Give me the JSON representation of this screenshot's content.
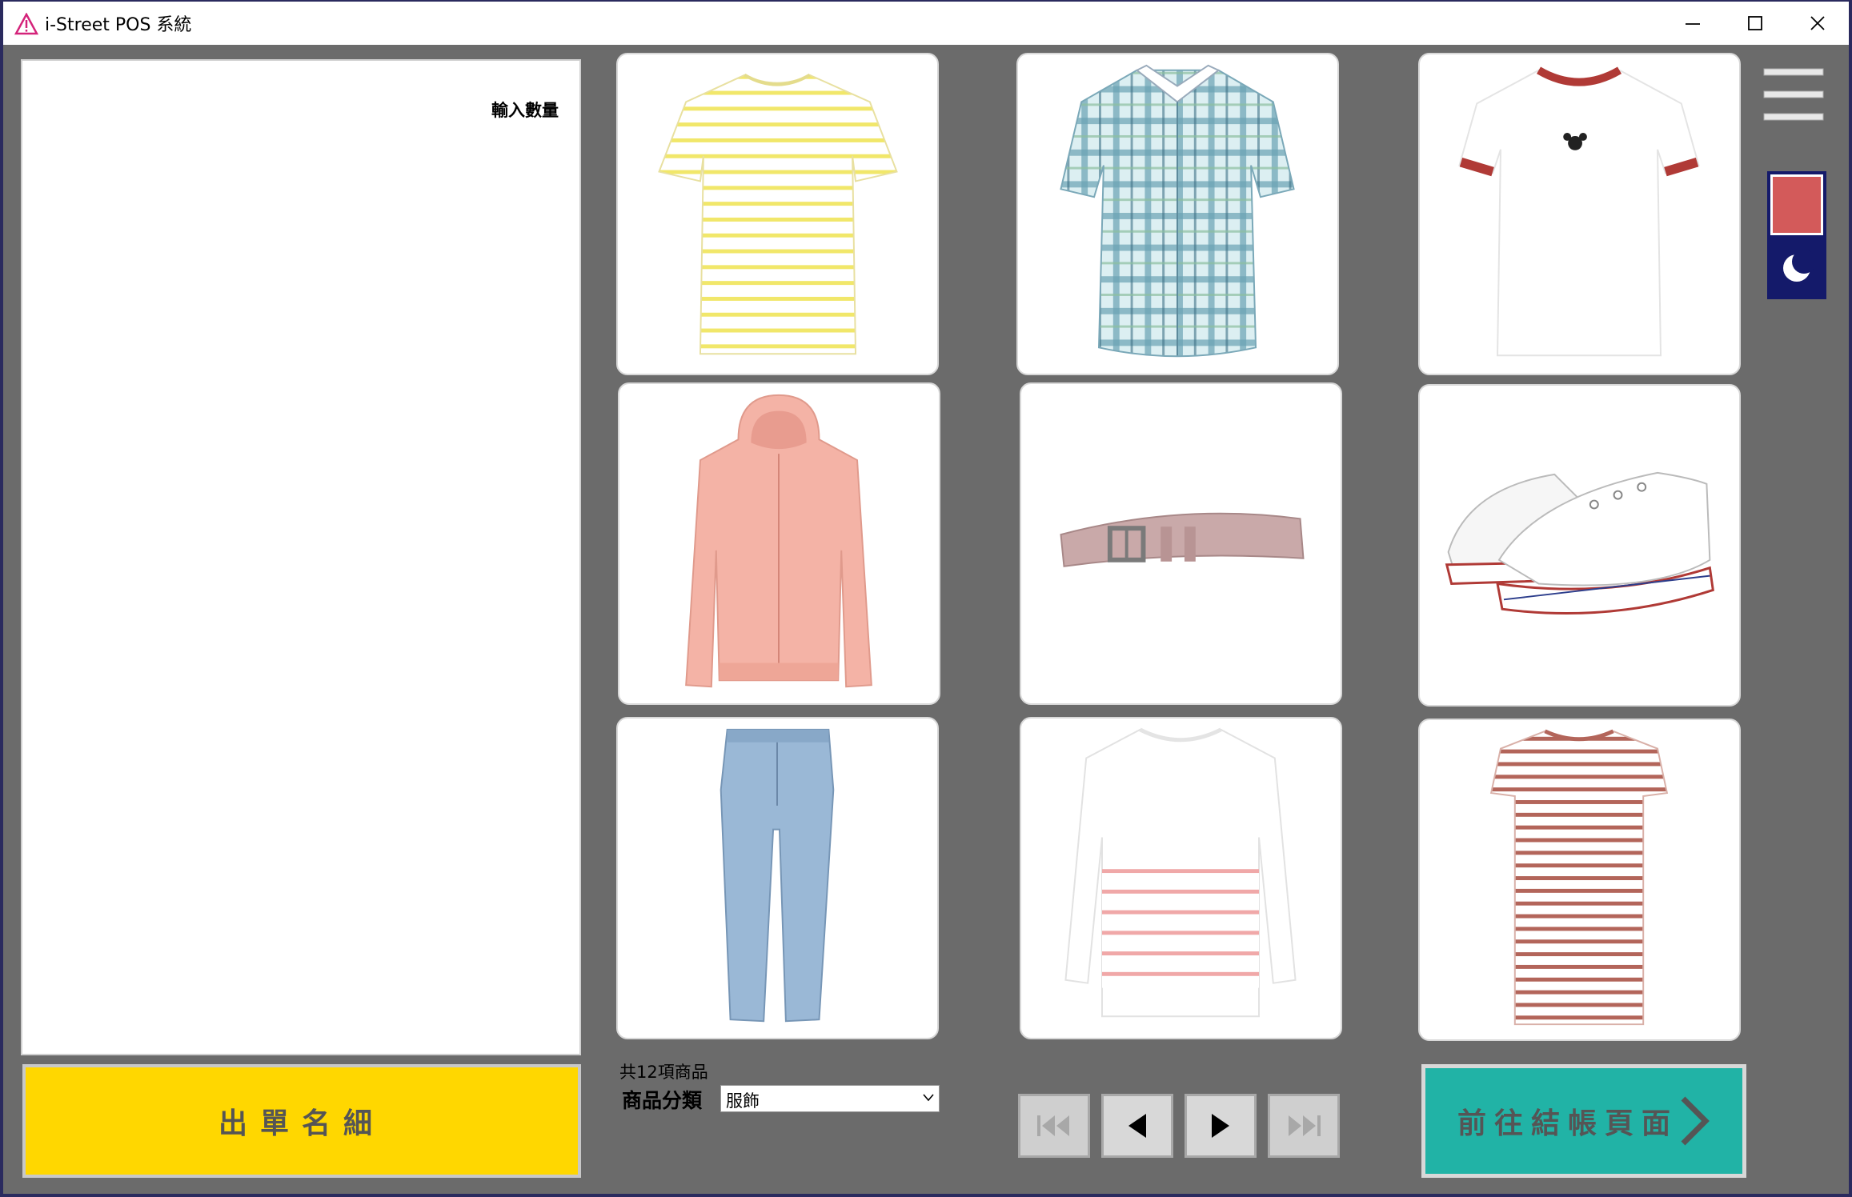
{
  "window": {
    "title": "i-Street POS 系統",
    "app_icon": "warning-triangle-icon",
    "controls": [
      "minimize-icon",
      "maximize-icon",
      "close-icon"
    ]
  },
  "order_panel": {
    "qty_label": "輸入數量",
    "order_button_label": "出單名細"
  },
  "products": [
    {
      "id": "yellow-striped-tee",
      "icon": "striped-tshirt-icon",
      "colors": [
        "#ffffff",
        "#f3ea6e"
      ]
    },
    {
      "id": "plaid-shirt",
      "icon": "plaid-shirt-icon",
      "colors": [
        "#d8eef2",
        "#5f9fb0"
      ]
    },
    {
      "id": "ringer-tee",
      "icon": "ringer-tshirt-icon",
      "colors": [
        "#ffffff",
        "#b03a36"
      ]
    },
    {
      "id": "pink-hoodie",
      "icon": "hoodie-icon",
      "colors": [
        "#f4b3a6"
      ]
    },
    {
      "id": "mauve-belt",
      "icon": "belt-icon",
      "colors": [
        "#c9a9a9"
      ]
    },
    {
      "id": "white-sneakers",
      "icon": "sneaker-icon",
      "colors": [
        "#ffffff",
        "#b03a36"
      ]
    },
    {
      "id": "blue-jeans",
      "icon": "jeans-icon",
      "colors": [
        "#9ab8d6"
      ]
    },
    {
      "id": "pink-striped-sweater",
      "icon": "striped-sweater-icon",
      "colors": [
        "#ffffff",
        "#f0a8a8"
      ]
    },
    {
      "id": "striped-dress",
      "icon": "striped-dress-icon",
      "colors": [
        "#ffffff",
        "#b3655a"
      ]
    }
  ],
  "listing": {
    "count_text": "共12項商品",
    "category_label": "商品分類",
    "category_value": "服飾"
  },
  "pager": {
    "buttons": [
      "first-page-icon",
      "prev-page-icon",
      "next-page-icon",
      "last-page-icon"
    ]
  },
  "checkout": {
    "label": "前往結帳頁面",
    "icon": "chevron-right-icon",
    "color": "#21b3a6"
  },
  "side_tools": {
    "menu_icon": "hamburger-menu-icon",
    "theme_colors": [
      "#d35a5a",
      "#141a6a"
    ],
    "dark_icon": "moon-icon"
  }
}
